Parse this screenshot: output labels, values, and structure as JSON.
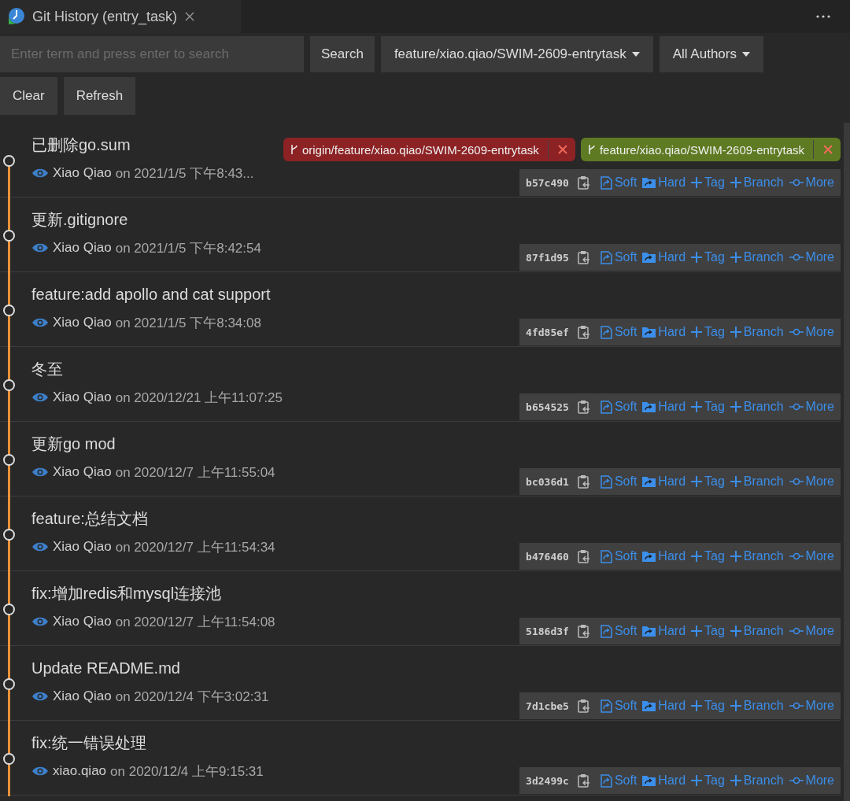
{
  "tab": {
    "title": "Git History (entry_task)"
  },
  "search": {
    "placeholder": "Enter term and press enter to search",
    "button": "Search"
  },
  "branch_filter": {
    "label": "feature/xiao.qiao/SWIM-2609-entrytask"
  },
  "author_filter": {
    "label": "All Authors"
  },
  "buttons": [
    "Clear",
    "Refresh"
  ],
  "commits": [
    {
      "subject": "已删除go.sum",
      "author": "Xiao Qiao",
      "date": "on 2021/1/5 下午8:43...",
      "hash": "b57c490",
      "refs": [
        {
          "name": "origin/feature/xiao.qiao/SWIM-2609-entrytask",
          "color": "#8c2224"
        },
        {
          "name": "feature/xiao.qiao/SWIM-2609-entrytask",
          "color": "#5e7a22"
        }
      ],
      "actions": [
        {
          "kind": "soft",
          "label": "Soft"
        },
        {
          "kind": "hard",
          "label": "Hard"
        },
        {
          "kind": "tag",
          "label": "Tag"
        },
        {
          "kind": "branch",
          "label": "Branch"
        },
        {
          "kind": "more",
          "label": "More"
        }
      ]
    },
    {
      "subject": "更新.gitignore",
      "author": "Xiao Qiao",
      "date": "on 2021/1/5 下午8:42:54",
      "hash": "87f1d95",
      "actions": [
        {
          "kind": "soft",
          "label": "Soft"
        },
        {
          "kind": "hard",
          "label": "Hard"
        },
        {
          "kind": "tag",
          "label": "Tag"
        },
        {
          "kind": "branch",
          "label": "Branch"
        },
        {
          "kind": "more",
          "label": "More"
        }
      ]
    },
    {
      "subject": "feature:add apollo and cat support",
      "author": "Xiao Qiao",
      "date": "on 2021/1/5 下午8:34:08",
      "hash": "4fd85ef",
      "actions": [
        {
          "kind": "soft",
          "label": "Soft"
        },
        {
          "kind": "hard",
          "label": "Hard"
        },
        {
          "kind": "tag",
          "label": "Tag"
        },
        {
          "kind": "branch",
          "label": "Branch"
        },
        {
          "kind": "more",
          "label": "More"
        }
      ]
    },
    {
      "subject": "冬至",
      "author": "Xiao Qiao",
      "date": "on 2020/12/21 上午11:07:25",
      "hash": "b654525",
      "actions": [
        {
          "kind": "soft",
          "label": "Soft"
        },
        {
          "kind": "hard",
          "label": "Hard"
        },
        {
          "kind": "tag",
          "label": "Tag"
        },
        {
          "kind": "branch",
          "label": "Branch"
        },
        {
          "kind": "more",
          "label": "More"
        }
      ]
    },
    {
      "subject": "更新go mod",
      "author": "Xiao Qiao",
      "date": "on 2020/12/7 上午11:55:04",
      "hash": "bc036d1",
      "actions": [
        {
          "kind": "soft",
          "label": "Soft"
        },
        {
          "kind": "hard",
          "label": "Hard"
        },
        {
          "kind": "tag",
          "label": "Tag"
        },
        {
          "kind": "branch",
          "label": "Branch"
        },
        {
          "kind": "more",
          "label": "More"
        }
      ]
    },
    {
      "subject": "feature:总结文档",
      "author": "Xiao Qiao",
      "date": "on 2020/12/7 上午11:54:34",
      "hash": "b476460",
      "actions": [
        {
          "kind": "soft",
          "label": "Soft"
        },
        {
          "kind": "hard",
          "label": "Hard"
        },
        {
          "kind": "tag",
          "label": "Tag"
        },
        {
          "kind": "branch",
          "label": "Branch"
        },
        {
          "kind": "more",
          "label": "More"
        }
      ]
    },
    {
      "subject": "fix:增加redis和mysql连接池",
      "author": "Xiao Qiao",
      "date": "on 2020/12/7 上午11:54:08",
      "hash": "5186d3f",
      "actions": [
        {
          "kind": "soft",
          "label": "Soft"
        },
        {
          "kind": "hard",
          "label": "Hard"
        },
        {
          "kind": "tag",
          "label": "Tag"
        },
        {
          "kind": "branch",
          "label": "Branch"
        },
        {
          "kind": "more",
          "label": "More"
        }
      ]
    },
    {
      "subject": "Update README.md",
      "author": "Xiao Qiao",
      "date": "on 2020/12/4 下午3:02:31",
      "hash": "7d1cbe5",
      "actions": [
        {
          "kind": "soft",
          "label": "Soft"
        },
        {
          "kind": "hard",
          "label": "Hard"
        },
        {
          "kind": "tag",
          "label": "Tag"
        },
        {
          "kind": "branch",
          "label": "Branch"
        },
        {
          "kind": "more",
          "label": "More"
        }
      ]
    },
    {
      "subject": "fix:统一错误处理",
      "author": "xiao.qiao",
      "date": "on 2020/12/4 上午9:15:31",
      "hash": "3d2499c",
      "actions": [
        {
          "kind": "soft",
          "label": "Soft"
        },
        {
          "kind": "hard",
          "label": "Hard"
        },
        {
          "kind": "tag",
          "label": "Tag"
        },
        {
          "kind": "branch",
          "label": "Branch"
        },
        {
          "kind": "more",
          "label": "More"
        }
      ]
    }
  ]
}
